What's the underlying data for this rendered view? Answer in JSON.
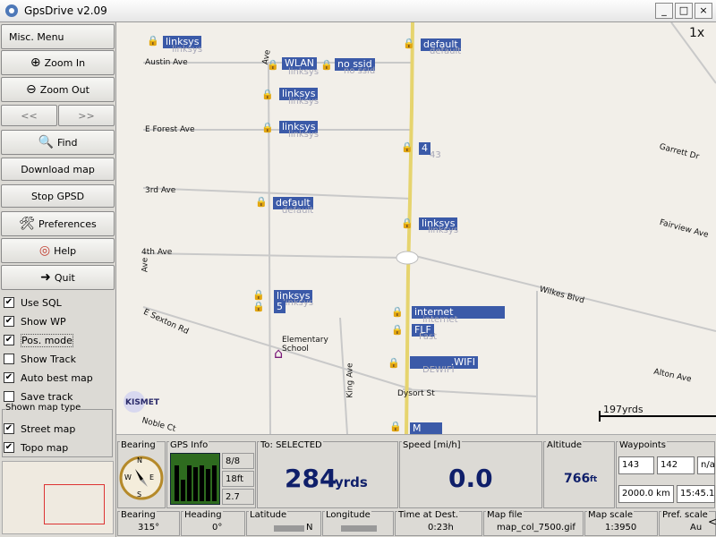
{
  "window": {
    "title": "GpsDrive v2.09",
    "min": "_",
    "max": "□",
    "close": "×"
  },
  "sidebar": {
    "misc_menu": "Misc. Menu",
    "zoom_in": "Zoom In",
    "zoom_out": "Zoom Out",
    "prev": "<<",
    "next": ">>",
    "find": "Find",
    "download_map": "Download map",
    "stop_gpsd": "Stop GPSD",
    "preferences": "Preferences",
    "help": "Help",
    "quit": "Quit",
    "checks": [
      {
        "label": "Use SQL",
        "checked": true
      },
      {
        "label": "Show WP",
        "checked": true
      },
      {
        "label": "Pos. mode",
        "checked": true
      },
      {
        "label": "Show Track",
        "checked": false
      },
      {
        "label": "Auto best map",
        "checked": true
      },
      {
        "label": "Save track",
        "checked": false
      }
    ],
    "map_type_header": "Shown map type",
    "map_types": [
      {
        "label": "Street map",
        "checked": true
      },
      {
        "label": "Topo map",
        "checked": true
      }
    ]
  },
  "map": {
    "corner_text": "1x",
    "scale_label": "197yrds",
    "streets": [
      "Austin Ave",
      "E Forest Ave",
      "3rd Ave",
      "4th Ave",
      "E Sexton Rd",
      "Garrett Dr",
      "Fairview Ave",
      "Wilkes Blvd",
      "Alton Ave",
      "King Ave",
      "Dysort St",
      "Noble Ct",
      "Ave",
      "Ave"
    ],
    "poi": {
      "school": "Elementary School",
      "kismet": "KISMET"
    },
    "waypoints": [
      {
        "label": "linksys",
        "ghost": "linksys"
      },
      {
        "label": "WLAN",
        "ghost": "linksys"
      },
      {
        "label": "no ssid",
        "ghost": "no ssid"
      },
      {
        "label": "linksys",
        "ghost": "linksys"
      },
      {
        "label": "linksys",
        "ghost": "linksys"
      },
      {
        "label": "default",
        "ghost": "default"
      },
      {
        "label": "default",
        "ghost": "default"
      },
      {
        "label": "4",
        "ghost": "43"
      },
      {
        "label": "linksys",
        "ghost": "linksys"
      },
      {
        "label": "linksys",
        "ghost": "linksys"
      },
      {
        "label": "5",
        "ghost": ""
      },
      {
        "label": "internet",
        "ghost": "internet"
      },
      {
        "label": "FLF",
        "ghost": "Fast"
      },
      {
        "label": ".WIFI",
        "ghost": "DEWIFI"
      },
      {
        "label": "M",
        "ghost": ""
      }
    ]
  },
  "status": {
    "bearing_label": "Bearing",
    "compass": {
      "n": "N",
      "e": "E",
      "s": "S",
      "w": "W"
    },
    "gps_info_label": "GPS Info",
    "sats": "8/8",
    "gps_alt": "18ft",
    "hdop": "2.7",
    "to_label": "To: SELECTED",
    "to_value": "284",
    "to_unit": "yrds",
    "speed_label": "Speed [mi/h]",
    "speed_value": "0.0",
    "altitude_label": "Altitude",
    "altitude_value": "766",
    "altitude_unit": "ft",
    "waypoints_label": "Waypoints",
    "wp_a": "143",
    "wp_b": "142",
    "wp_c": "n/a",
    "wp_dist": "2000.0 km",
    "wp_time": "15:45.10"
  },
  "bottombar": {
    "bearing_label": "Bearing",
    "bearing_value": "315°",
    "heading_label": "Heading",
    "heading_value": "0°",
    "latitude_label": "Latitude",
    "latitude_value": "N",
    "longitude_label": "Longitude",
    "longitude_value": "",
    "time_label": "Time at Dest.",
    "time_value": "0:23h",
    "mapfile_label": "Map file",
    "mapfile_value": "map_col_7500.gif",
    "mapscale_label": "Map scale",
    "mapscale_value": "1:3950",
    "prefscale_label": "Pref. scale",
    "prefscale_value": "Au",
    "arrow": "<"
  }
}
